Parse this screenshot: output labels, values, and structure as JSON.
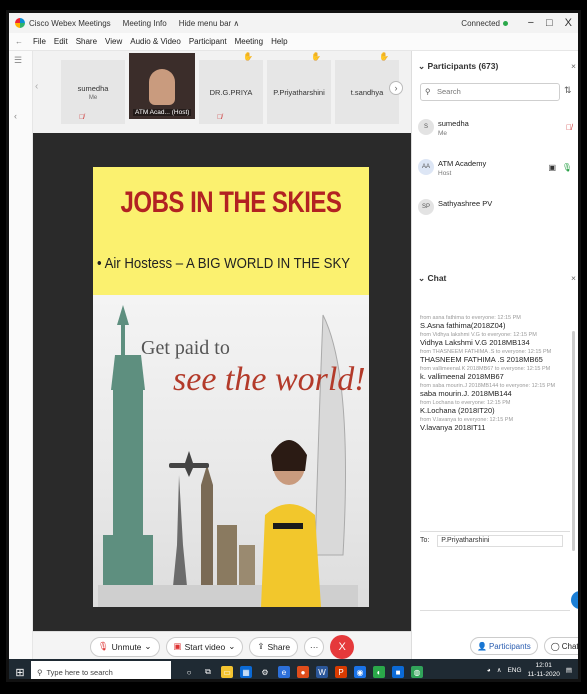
{
  "titlebar": {
    "app_title": "Cisco Webex Meetings",
    "meeting_info": "Meeting Info",
    "hide_menu": "Hide menu bar ∧",
    "status": "Connected",
    "minimize": "−",
    "restore": "□",
    "close": "X"
  },
  "menu": {
    "items": [
      "File",
      "Edit",
      "Share",
      "View",
      "Audio & Video",
      "Participant",
      "Meeting",
      "Help"
    ]
  },
  "thumbnails": [
    {
      "name": "sumedha",
      "sub": "Me"
    },
    {
      "name": "ATM Acad... (Host)",
      "sub": ""
    },
    {
      "name": "DR.G.PRIYA",
      "sub": ""
    },
    {
      "name": "P.Priyatharshini",
      "sub": ""
    },
    {
      "name": "t.sandhya",
      "sub": ""
    }
  ],
  "slide": {
    "title": "JOBS IN THE SKIES",
    "bullet": "Air Hostess – A BIG WORLD IN THE SKY",
    "tagline_1": "Get paid to",
    "tagline_2": "see the world!"
  },
  "controls": {
    "unmute": "Unmute",
    "start_video": "Start video",
    "share": "Share",
    "more": "···",
    "end": "X"
  },
  "participants": {
    "header": "Participants (673)",
    "search_placeholder": "Search",
    "list": [
      {
        "initials": "S",
        "name": "sumedha",
        "role": "Me"
      },
      {
        "initials": "AA",
        "name": "ATM Academy",
        "role": "Host"
      },
      {
        "initials": "SP",
        "name": "Sathyashree PV",
        "role": ""
      }
    ]
  },
  "chat": {
    "header": "Chat",
    "messages": [
      {
        "from": "from asna fathima to everyone:   12:15 PM",
        "text": "S.Asna fathima(2018Z04)"
      },
      {
        "from": "from Vidhya lakshmi V.G to everyone:   12:15 PM",
        "text": "Vidhya Lakshmi V.G 2018MB134"
      },
      {
        "from": "from THASNEEM FATHIMA .S to everyone:   12:15 PM",
        "text": "THASNEEM FATHIMA .S  2018MB65"
      },
      {
        "from": "from vallimeenal.K 2018MB67 to everyone:   12:15 PM",
        "text": "k. vallimeenal 2018MB67"
      },
      {
        "from": "from saba mourin.J 2018MB144 to everyone:   12:15 PM",
        "text": "saba mourin.J. 2018MB144"
      },
      {
        "from": "from Lochana to everyone:   12:15 PM",
        "text": "K.Lochana (2018IT20)"
      },
      {
        "from": "from V.lavanya to everyone:   12:15 PM",
        "text": "V.lavanya 2018IT11"
      }
    ],
    "to_label": "To:",
    "to_value": "P.Priyatharshini"
  },
  "panel_buttons": {
    "participants": "Participants",
    "chat": "Chat",
    "more": "···"
  },
  "taskbar": {
    "search_placeholder": "Type here to search",
    "lang": "ENG",
    "time": "12:01",
    "date": "11-11-2020"
  }
}
